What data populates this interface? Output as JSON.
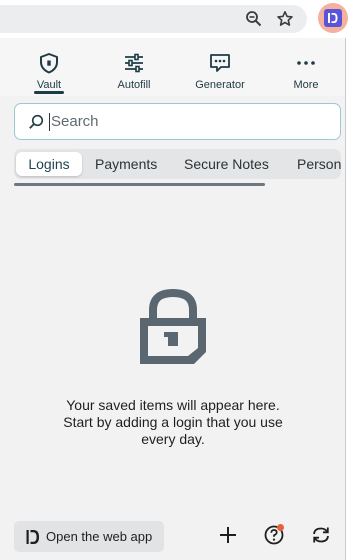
{
  "browser": {
    "zoom_icon": "zoom-icon",
    "bookmark_icon": "star-icon",
    "extension_icon": "dashlane-logo-icon",
    "extension_bg": "#f5b1a0",
    "extension_logo_color": "#5a55d8"
  },
  "nav": {
    "tabs": [
      {
        "label": "Vault",
        "icon": "vault-shield-icon",
        "active": true
      },
      {
        "label": "Autofill",
        "icon": "sliders-icon",
        "active": false
      },
      {
        "label": "Generator",
        "icon": "chat-dots-icon",
        "active": false
      },
      {
        "label": "More",
        "icon": "more-dots-icon",
        "active": false
      }
    ]
  },
  "search": {
    "placeholder": "Search",
    "value": ""
  },
  "categories": [
    {
      "label": "Logins",
      "active": true
    },
    {
      "label": "Payments",
      "active": false
    },
    {
      "label": "Secure Notes",
      "active": false
    },
    {
      "label": "Person",
      "active": false
    }
  ],
  "empty_state": {
    "icon": "lock-icon",
    "lines": [
      "Your saved items will appear here.",
      "Start by adding a login that you use",
      "every day."
    ]
  },
  "footer": {
    "open_web_app_label": "Open the web app",
    "add_icon": "plus-icon",
    "help_icon": "help-icon",
    "sync_icon": "sync-icon",
    "notification_color": "#e8613a"
  },
  "colors": {
    "popup_bg": "#f2f2f3",
    "accent": "#1d3c46",
    "search_border": "#9fc6d3"
  }
}
